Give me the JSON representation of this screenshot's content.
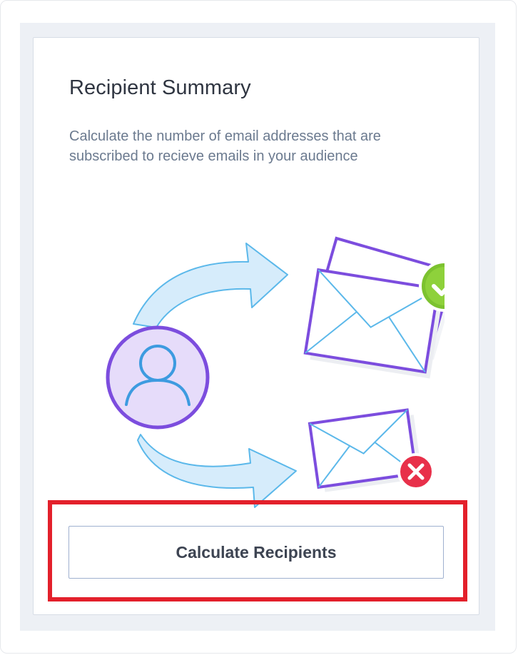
{
  "card": {
    "title": "Recipient Summary",
    "description": "Calculate the number of email addresses that are subscribed to recieve emails in your audience",
    "button_label": "Calculate Recipients"
  },
  "colors": {
    "arrow_fill": "#d6ecfb",
    "arrow_stroke": "#5bb8ea",
    "envelope_stroke": "#7c4dde",
    "avatar_fill": "#e6dcfa",
    "success": "#7cc22f",
    "error": "#e8304a",
    "highlight": "#e3202b"
  },
  "icons": {
    "avatar": "user-avatar-icon",
    "subscribed": "envelopes-check-icon",
    "unsubscribed": "envelope-x-icon"
  }
}
